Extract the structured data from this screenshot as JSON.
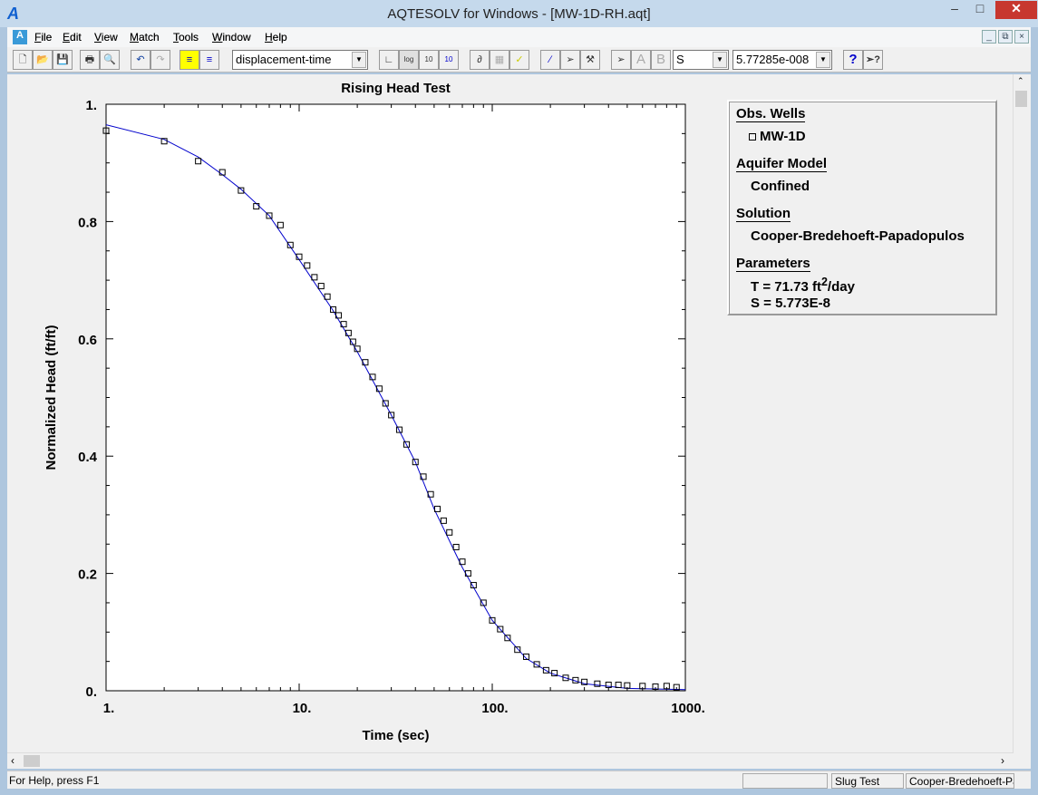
{
  "window": {
    "title": "AQTESOLV for Windows - [MW-1D-RH.aqt]",
    "app_icon": "aqtesolv-logo-icon"
  },
  "menu": [
    {
      "label": "File",
      "u": "F",
      "rest": "ile"
    },
    {
      "label": "Edit",
      "u": "E",
      "rest": "dit"
    },
    {
      "label": "View",
      "u": "V",
      "rest": "iew"
    },
    {
      "label": "Match",
      "u": "M",
      "rest": "atch"
    },
    {
      "label": "Tools",
      "u": "T",
      "rest": "ools"
    },
    {
      "label": "Window",
      "u": "W",
      "rest": "indow"
    },
    {
      "label": "Help",
      "u": "H",
      "rest": "elp"
    }
  ],
  "toolbar": {
    "plot_type": "displacement-time",
    "param_select": "S",
    "param_value": "5.77285e-008",
    "btn_a": "A",
    "btn_b": "B"
  },
  "chart_data": {
    "type": "scatter",
    "title": "Rising Head Test",
    "xlabel": "Time (sec)",
    "ylabel": "Normalized Head (ft/ft)",
    "xscale": "log",
    "xlim": [
      1,
      1000
    ],
    "ylim": [
      0,
      1
    ],
    "xticks": [
      "1.",
      "10.",
      "100.",
      "1000."
    ],
    "yticks": [
      "0.",
      "0.2",
      "0.4",
      "0.6",
      "0.8",
      "1."
    ],
    "grid": false,
    "series": [
      {
        "name": "MW-1D",
        "kind": "markers",
        "marker": "open-square",
        "color": "#000000",
        "x": [
          1,
          2,
          3,
          4,
          5,
          6,
          7,
          8,
          9,
          10,
          11,
          12,
          13,
          14,
          15,
          16,
          17,
          18,
          19,
          20,
          22,
          24,
          26,
          28,
          30,
          33,
          36,
          40,
          44,
          48,
          52,
          56,
          60,
          65,
          70,
          75,
          80,
          90,
          100,
          110,
          120,
          135,
          150,
          170,
          190,
          210,
          240,
          270,
          300,
          350,
          400,
          450,
          500,
          600,
          700,
          800,
          900
        ],
        "y": [
          0.955,
          0.937,
          0.903,
          0.884,
          0.853,
          0.826,
          0.81,
          0.794,
          0.76,
          0.74,
          0.725,
          0.705,
          0.69,
          0.672,
          0.65,
          0.64,
          0.625,
          0.61,
          0.595,
          0.583,
          0.56,
          0.535,
          0.515,
          0.49,
          0.47,
          0.445,
          0.42,
          0.39,
          0.365,
          0.335,
          0.31,
          0.29,
          0.27,
          0.245,
          0.22,
          0.2,
          0.18,
          0.15,
          0.12,
          0.105,
          0.09,
          0.07,
          0.058,
          0.045,
          0.035,
          0.03,
          0.022,
          0.018,
          0.015,
          0.012,
          0.01,
          0.01,
          0.009,
          0.008,
          0.007,
          0.008,
          0.006
        ]
      },
      {
        "kind": "fit-line",
        "color": "#0000cc",
        "x": [
          1,
          2,
          3,
          4,
          5,
          7,
          10,
          15,
          20,
          30,
          40,
          50,
          70,
          100,
          150,
          200,
          300,
          500,
          1000
        ],
        "y": [
          0.965,
          0.94,
          0.91,
          0.88,
          0.855,
          0.81,
          0.735,
          0.648,
          0.578,
          0.47,
          0.39,
          0.31,
          0.21,
          0.12,
          0.055,
          0.03,
          0.012,
          0.004,
          0.002
        ]
      }
    ]
  },
  "legend": {
    "obs_wells_heading": "Obs. Wells",
    "well": "MW-1D",
    "aquifer_heading": "Aquifer Model",
    "aquifer": "Confined",
    "solution_heading": "Solution",
    "solution": "Cooper-Bredehoeft-Papadopulos",
    "parameters_heading": "Parameters",
    "T_prefix": "T = 71.73 ft",
    "T_sup": "2",
    "T_suffix": "/day",
    "S": "S = 5.773E-8"
  },
  "status": {
    "help": "For Help, press F1",
    "panel1": "",
    "panel2": "Slug Test",
    "panel3": "Cooper-Bredehoeft-Pa"
  }
}
